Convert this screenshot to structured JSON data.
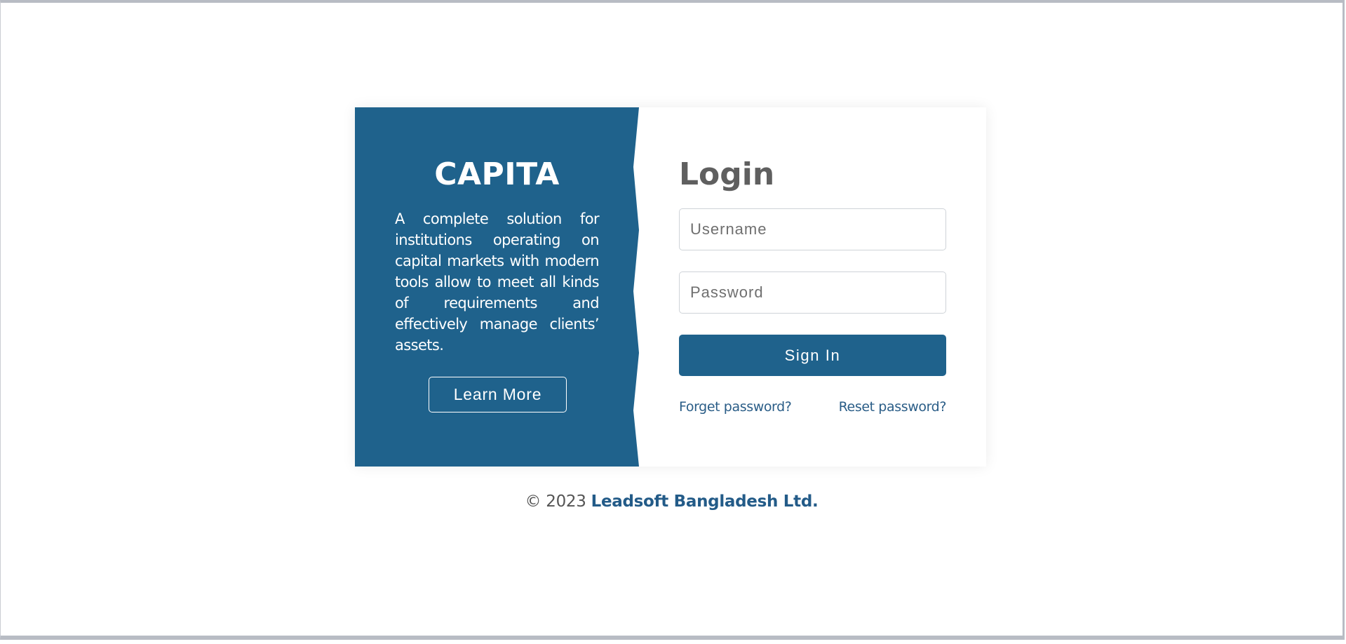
{
  "brand": {
    "title": "CAPITA",
    "description": "A complete solution for institutions operating on capital markets with modern tools allow to meet all kinds of requirements and effectively manage clients’ assets.",
    "learn_more_label": "Learn More"
  },
  "login": {
    "title": "Login",
    "username_placeholder": "Username",
    "password_placeholder": "Password",
    "username_value": "",
    "password_value": "",
    "signin_label": "Sign In",
    "forget_password_label": "Forget password?",
    "reset_password_label": "Reset password?"
  },
  "footer": {
    "copyright": "© 2023",
    "company": "Leadsoft Bangladesh Ltd."
  },
  "colors": {
    "brand_blue": "#1f628c",
    "title_gray": "#5f5f5f",
    "link_blue": "#2a5d87"
  }
}
